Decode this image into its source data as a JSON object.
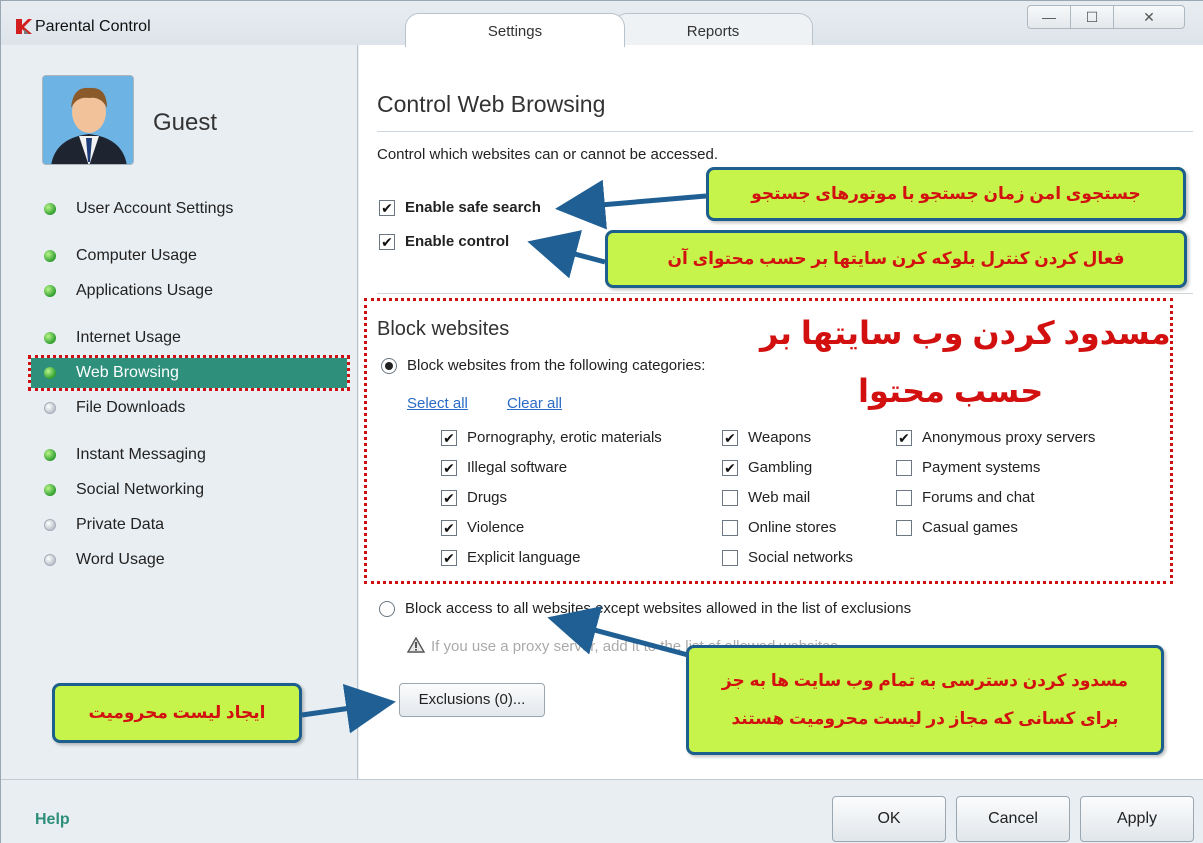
{
  "window": {
    "title": "Parental Control",
    "tabs": [
      "Settings",
      "Reports"
    ],
    "controls": {
      "minimize": "—",
      "maximize": "☐",
      "close": "✕"
    }
  },
  "sidebar": {
    "user": "Guest",
    "items": [
      {
        "label": "User Account Settings",
        "status": "green"
      },
      {
        "label": "Computer Usage",
        "status": "green"
      },
      {
        "label": "Applications Usage",
        "status": "green"
      },
      {
        "label": "Internet Usage",
        "status": "green"
      },
      {
        "label": "Web Browsing",
        "status": "green",
        "selected": true
      },
      {
        "label": "File Downloads",
        "status": "grey"
      },
      {
        "label": "Instant Messaging",
        "status": "green"
      },
      {
        "label": "Social Networking",
        "status": "green"
      },
      {
        "label": "Private Data",
        "status": "grey"
      },
      {
        "label": "Word Usage",
        "status": "grey"
      }
    ]
  },
  "main": {
    "title": "Control Web Browsing",
    "description": "Control which websites can or cannot be accessed.",
    "safe_search": {
      "label": "Enable safe search",
      "checked": true
    },
    "enable_control": {
      "label": "Enable control",
      "checked": true
    },
    "block_title": "Block websites",
    "radio_categories": {
      "label": "Block websites from the following categories:",
      "selected": true
    },
    "select_all": "Select all",
    "clear_all": "Clear all",
    "categories": [
      {
        "label": "Pornography, erotic materials",
        "checked": true
      },
      {
        "label": "Illegal software",
        "checked": true
      },
      {
        "label": "Drugs",
        "checked": true
      },
      {
        "label": "Violence",
        "checked": true
      },
      {
        "label": "Explicit language",
        "checked": true
      },
      {
        "label": "Weapons",
        "checked": true
      },
      {
        "label": "Gambling",
        "checked": true
      },
      {
        "label": "Web mail",
        "checked": false
      },
      {
        "label": "Online stores",
        "checked": false
      },
      {
        "label": "Social networks",
        "checked": false
      },
      {
        "label": "Anonymous proxy servers",
        "checked": true
      },
      {
        "label": "Payment systems",
        "checked": false
      },
      {
        "label": "Forums and chat",
        "checked": false
      },
      {
        "label": "Casual games",
        "checked": false
      }
    ],
    "radio_all": {
      "label": "Block access to all websites except websites allowed in the list of exclusions",
      "selected": false
    },
    "warning": "If you use a proxy server, add it to the list of allowed websites.",
    "exclusions_button": "Exclusions (0)..."
  },
  "footer": {
    "help": "Help",
    "ok": "OK",
    "cancel": "Cancel",
    "apply": "Apply"
  },
  "annotations": {
    "safe_search_note": "جستجوی امن زمان جستجو با موتورهای جستجو",
    "control_note": "فعال کردن کنترل بلوکه کرن سایتها بر حسب محتوای آن",
    "block_title_line1": "مسدود کردن وب سایتها بر",
    "block_title_line2": "حسب محتوا",
    "block_all_note": "مسدود کردن دسترسی به تمام وب سایت ها به جز برای کسانی که مجاز در لیست محرومیت هستند",
    "exclusions_note": "ایجاد لیست محرومیت"
  },
  "colors": {
    "accent": "#2e8f7b",
    "link": "#2a6bc4",
    "annotation_bg": "#c6f44a",
    "annotation_text": "#d21010",
    "annotation_border": "#1c5f8c"
  }
}
